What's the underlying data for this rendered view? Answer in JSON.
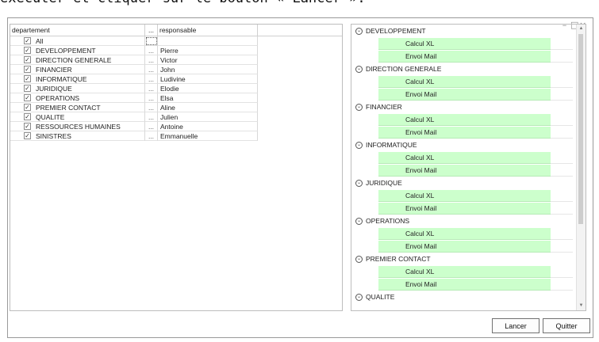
{
  "caption": "exécuter et cliquer sur le bouton « Lancer ».",
  "window": {
    "minimize": "–",
    "maximize": "□",
    "close": "×"
  },
  "grid": {
    "headers": {
      "departement": "departement",
      "ellipsis": "...",
      "responsable": "responsable"
    },
    "rows": [
      {
        "dept": "All",
        "ellipsis": "",
        "resp": "",
        "checked": "✓"
      },
      {
        "dept": "DEVELOPPEMENT",
        "ellipsis": "...",
        "resp": "Pierre",
        "checked": "✓"
      },
      {
        "dept": "DIRECTION GENERALE",
        "ellipsis": "...",
        "resp": "Victor",
        "checked": "✓"
      },
      {
        "dept": "FINANCIER",
        "ellipsis": "...",
        "resp": "John",
        "checked": "✓"
      },
      {
        "dept": "INFORMATIQUE",
        "ellipsis": "...",
        "resp": "Ludivine",
        "checked": "✓"
      },
      {
        "dept": "JURIDIQUE",
        "ellipsis": "...",
        "resp": "Elodie",
        "checked": "✓"
      },
      {
        "dept": "OPERATIONS",
        "ellipsis": "...",
        "resp": "Elsa",
        "checked": "✓"
      },
      {
        "dept": "PREMIER CONTACT",
        "ellipsis": "...",
        "resp": "Aline",
        "checked": "✓"
      },
      {
        "dept": "QUALITE",
        "ellipsis": "...",
        "resp": "Julien",
        "checked": "✓"
      },
      {
        "dept": "RESSOURCES HUMAINES",
        "ellipsis": "...",
        "resp": "Antoine",
        "checked": "✓"
      },
      {
        "dept": "SINISTRES",
        "ellipsis": "...",
        "resp": "Emmanuelle",
        "checked": "✓"
      }
    ]
  },
  "tree": {
    "groups": [
      {
        "name": "DEVELOPPEMENT",
        "actions": [
          "Calcul XL",
          "Envoi Mail"
        ]
      },
      {
        "name": "DIRECTION GENERALE",
        "actions": [
          "Calcul XL",
          "Envoi Mail"
        ]
      },
      {
        "name": "FINANCIER",
        "actions": [
          "Calcul XL",
          "Envoi Mail"
        ]
      },
      {
        "name": "INFORMATIQUE",
        "actions": [
          "Calcul XL",
          "Envoi Mail"
        ]
      },
      {
        "name": "JURIDIQUE",
        "actions": [
          "Calcul XL",
          "Envoi Mail"
        ]
      },
      {
        "name": "OPERATIONS",
        "actions": [
          "Calcul XL",
          "Envoi Mail"
        ]
      },
      {
        "name": "PREMIER CONTACT",
        "actions": [
          "Calcul XL",
          "Envoi Mail"
        ]
      },
      {
        "name": "QUALITE",
        "actions": []
      }
    ],
    "collapse_glyph": "⌄",
    "action_bg": "#ccffcc"
  },
  "buttons": {
    "lancer": "Lancer",
    "quitter": "Quitter"
  }
}
